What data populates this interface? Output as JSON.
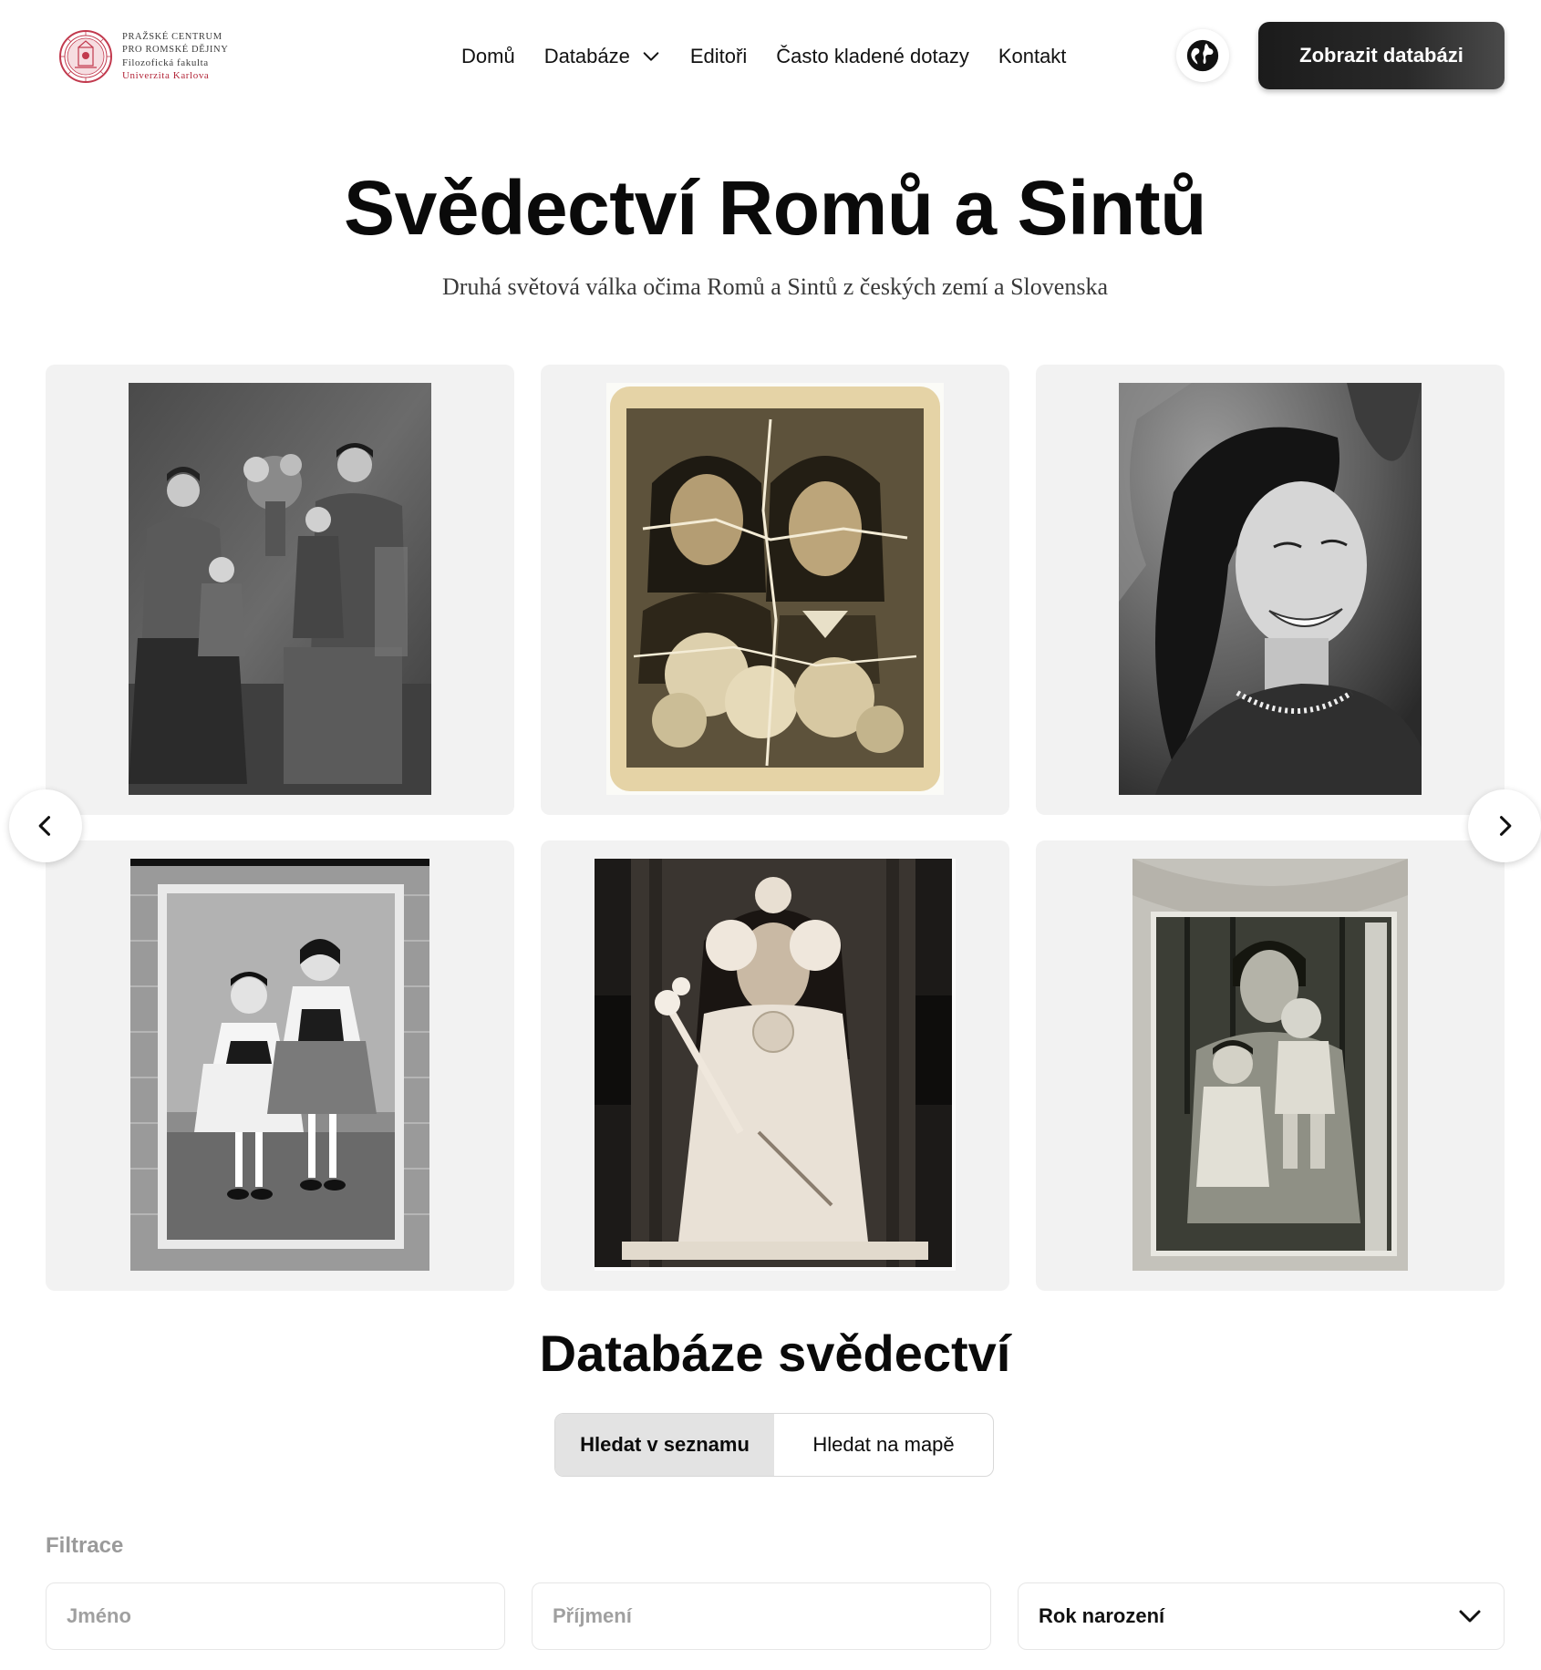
{
  "header": {
    "logo": {
      "line1": "Pražské centrum",
      "line2": "pro romské dějiny",
      "line3": "Filozofická fakulta",
      "line4": "Univerzita Karlova",
      "seal_color": "#c23a4e"
    },
    "nav": [
      {
        "label": "Domů"
      },
      {
        "label": "Databáze",
        "has_dropdown": true
      },
      {
        "label": "Editoři"
      },
      {
        "label": "Často kladené dotazy"
      },
      {
        "label": "Kontakt"
      }
    ],
    "language_icon": "globe-icon",
    "cta_label": "Zobrazit databázi"
  },
  "hero": {
    "title": "Svědectví Romů a Sintů",
    "subtitle": "Druhá světová válka očima Romů a Sintů z českých zemí a Slovenska"
  },
  "gallery": {
    "photos": [
      {
        "kind": "family-portrait",
        "tone": "grey"
      },
      {
        "kind": "two-girls-portrait",
        "tone": "sepia"
      },
      {
        "kind": "smiling-woman-portrait",
        "tone": "grey"
      },
      {
        "kind": "two-girls-folk-costume",
        "tone": "grey"
      },
      {
        "kind": "girl-first-communion",
        "tone": "sepia-dark"
      },
      {
        "kind": "woman-with-children",
        "tone": "grey-green"
      }
    ],
    "prev_icon": "chevron-left-icon",
    "next_icon": "chevron-right-icon"
  },
  "database": {
    "title": "Databáze svědectví",
    "tabs": [
      {
        "label": "Hledat v seznamu",
        "active": true
      },
      {
        "label": "Hledat na mapě",
        "active": false
      }
    ],
    "filter_label": "Filtrace",
    "first_name_placeholder": "Jméno",
    "last_name_placeholder": "Příjmení",
    "birth_year_label": "Rok narození"
  }
}
